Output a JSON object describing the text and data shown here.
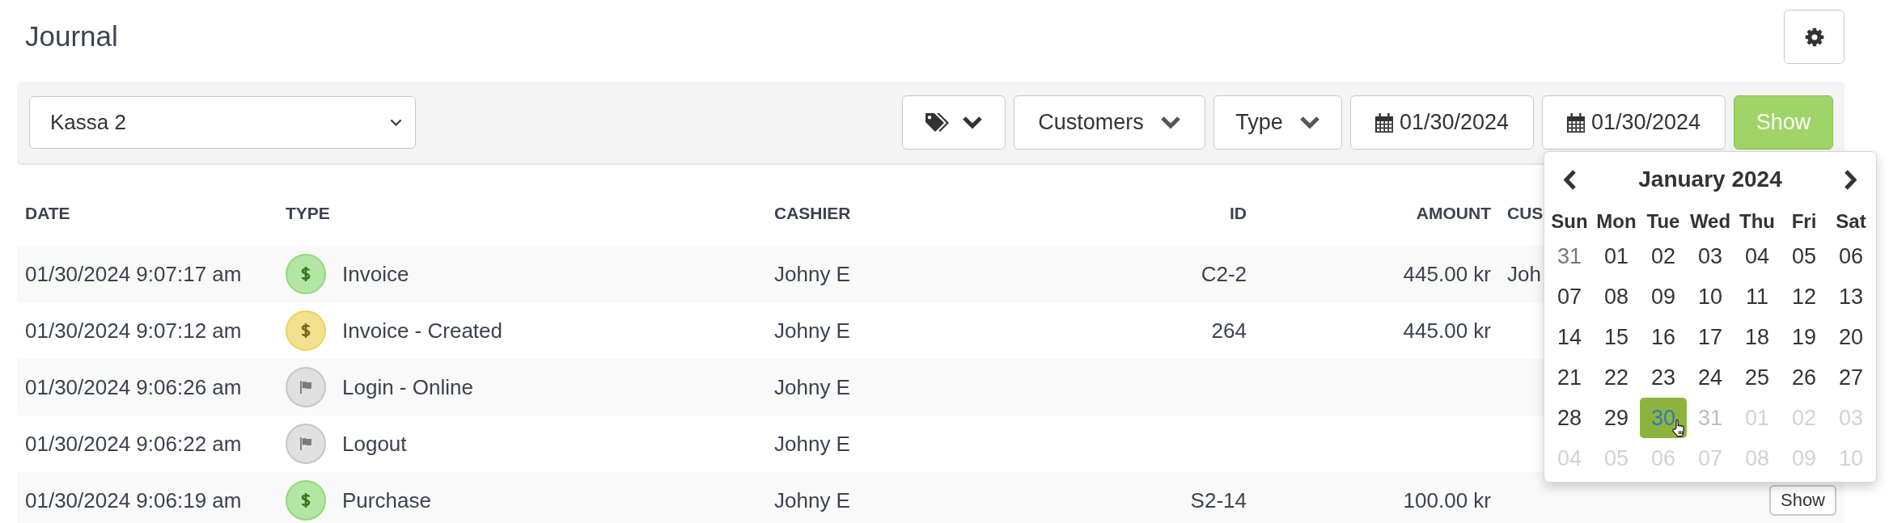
{
  "page": {
    "title": "Journal"
  },
  "toolbar": {
    "register_select": {
      "value": "Kassa 2"
    },
    "filters": [
      {
        "kind": "tags"
      },
      {
        "kind": "dropdown",
        "label": "Customers"
      },
      {
        "kind": "dropdown",
        "label": "Type"
      },
      {
        "kind": "date",
        "value": "01/30/2024"
      },
      {
        "kind": "date",
        "value": "01/30/2024"
      }
    ],
    "submit_button": "Show"
  },
  "table": {
    "columns": [
      "DATE",
      "TYPE",
      "CASHIER",
      "ID",
      "AMOUNT",
      "CUS"
    ],
    "rows": [
      {
        "date": "01/30/2024 9:07:17 am",
        "type": {
          "label": "Invoice",
          "kind": "dollar",
          "color": "#b3e5a4"
        },
        "cashier": "Johny E",
        "id": "C2-2",
        "amount": "445.00 kr",
        "column_6": "Joh"
      },
      {
        "date": "01/30/2024 9:07:12 am",
        "type": {
          "label": "Invoice - Created",
          "kind": "dollar",
          "color": "#f2e08e"
        },
        "cashier": "Johny E",
        "id": "264",
        "amount": "445.00 kr"
      },
      {
        "date": "01/30/2024 9:06:26 am",
        "type": {
          "label": "Login - Online",
          "kind": "flag",
          "color": "#e0e0e0"
        },
        "cashier": "Johny E"
      },
      {
        "date": "01/30/2024 9:06:22 am",
        "type": {
          "label": "Logout",
          "kind": "flag",
          "color": "#e0e0e0"
        },
        "cashier": "Johny E"
      },
      {
        "date": "01/30/2024 9:06:19 am",
        "type": {
          "label": "Purchase",
          "kind": "dollar",
          "color": "#b3e5a4"
        },
        "cashier": "Johny E",
        "id": "S2-14",
        "amount": "100.00 kr",
        "action": "Show"
      }
    ]
  },
  "datepicker": {
    "title": "January 2024",
    "weekdays": [
      "Sun",
      "Mon",
      "Tue",
      "Wed",
      "Thu",
      "Fri",
      "Sat"
    ],
    "weeks": [
      [
        {
          "label": "31",
          "other_month": true,
          "disabled": false,
          "selected": false
        },
        {
          "label": "01",
          "other_month": false,
          "disabled": false,
          "selected": false
        },
        {
          "label": "02",
          "other_month": false,
          "disabled": false,
          "selected": false
        },
        {
          "label": "03",
          "other_month": false,
          "disabled": false,
          "selected": false
        },
        {
          "label": "04",
          "other_month": false,
          "disabled": false,
          "selected": false
        },
        {
          "label": "05",
          "other_month": false,
          "disabled": false,
          "selected": false
        },
        {
          "label": "06",
          "other_month": false,
          "disabled": false,
          "selected": false
        }
      ],
      [
        {
          "label": "07",
          "other_month": false,
          "disabled": false,
          "selected": false
        },
        {
          "label": "08",
          "other_month": false,
          "disabled": false,
          "selected": false
        },
        {
          "label": "09",
          "other_month": false,
          "disabled": false,
          "selected": false
        },
        {
          "label": "10",
          "other_month": false,
          "disabled": false,
          "selected": false
        },
        {
          "label": "11",
          "other_month": false,
          "disabled": false,
          "selected": false
        },
        {
          "label": "12",
          "other_month": false,
          "disabled": false,
          "selected": false
        },
        {
          "label": "13",
          "other_month": false,
          "disabled": false,
          "selected": false
        }
      ],
      [
        {
          "label": "14",
          "other_month": false,
          "disabled": false,
          "selected": false
        },
        {
          "label": "15",
          "other_month": false,
          "disabled": false,
          "selected": false
        },
        {
          "label": "16",
          "other_month": false,
          "disabled": false,
          "selected": false
        },
        {
          "label": "17",
          "other_month": false,
          "disabled": false,
          "selected": false
        },
        {
          "label": "18",
          "other_month": false,
          "disabled": false,
          "selected": false
        },
        {
          "label": "19",
          "other_month": false,
          "disabled": false,
          "selected": false
        },
        {
          "label": "20",
          "other_month": false,
          "disabled": false,
          "selected": false
        }
      ],
      [
        {
          "label": "21",
          "other_month": false,
          "disabled": false,
          "selected": false
        },
        {
          "label": "22",
          "other_month": false,
          "disabled": false,
          "selected": false
        },
        {
          "label": "23",
          "other_month": false,
          "disabled": false,
          "selected": false
        },
        {
          "label": "24",
          "other_month": false,
          "disabled": false,
          "selected": false
        },
        {
          "label": "25",
          "other_month": false,
          "disabled": false,
          "selected": false
        },
        {
          "label": "26",
          "other_month": false,
          "disabled": false,
          "selected": false
        },
        {
          "label": "27",
          "other_month": false,
          "disabled": false,
          "selected": false
        }
      ],
      [
        {
          "label": "28",
          "other_month": false,
          "disabled": false,
          "selected": false
        },
        {
          "label": "29",
          "other_month": false,
          "disabled": false,
          "selected": false
        },
        {
          "label": "30",
          "other_month": false,
          "disabled": false,
          "selected": true
        },
        {
          "label": "31",
          "other_month": false,
          "disabled": true,
          "selected": false
        },
        {
          "label": "01",
          "other_month": true,
          "disabled": true,
          "selected": false
        },
        {
          "label": "02",
          "other_month": true,
          "disabled": true,
          "selected": false
        },
        {
          "label": "03",
          "other_month": true,
          "disabled": true,
          "selected": false
        }
      ],
      [
        {
          "label": "04",
          "other_month": true,
          "disabled": true,
          "selected": false
        },
        {
          "label": "05",
          "other_month": true,
          "disabled": true,
          "selected": false
        },
        {
          "label": "06",
          "other_month": true,
          "disabled": true,
          "selected": false
        },
        {
          "label": "07",
          "other_month": true,
          "disabled": true,
          "selected": false
        },
        {
          "label": "08",
          "other_month": true,
          "disabled": true,
          "selected": false
        },
        {
          "label": "09",
          "other_month": true,
          "disabled": true,
          "selected": false
        },
        {
          "label": "10",
          "other_month": true,
          "disabled": true,
          "selected": false
        }
      ]
    ]
  }
}
